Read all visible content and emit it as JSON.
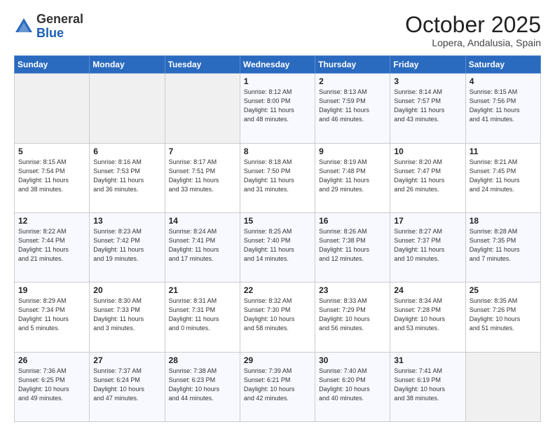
{
  "header": {
    "logo_general": "General",
    "logo_blue": "Blue",
    "month_title": "October 2025",
    "location": "Lopera, Andalusia, Spain"
  },
  "weekdays": [
    "Sunday",
    "Monday",
    "Tuesday",
    "Wednesday",
    "Thursday",
    "Friday",
    "Saturday"
  ],
  "weeks": [
    [
      {
        "day": "",
        "info": ""
      },
      {
        "day": "",
        "info": ""
      },
      {
        "day": "",
        "info": ""
      },
      {
        "day": "1",
        "info": "Sunrise: 8:12 AM\nSunset: 8:00 PM\nDaylight: 11 hours\nand 48 minutes."
      },
      {
        "day": "2",
        "info": "Sunrise: 8:13 AM\nSunset: 7:59 PM\nDaylight: 11 hours\nand 46 minutes."
      },
      {
        "day": "3",
        "info": "Sunrise: 8:14 AM\nSunset: 7:57 PM\nDaylight: 11 hours\nand 43 minutes."
      },
      {
        "day": "4",
        "info": "Sunrise: 8:15 AM\nSunset: 7:56 PM\nDaylight: 11 hours\nand 41 minutes."
      }
    ],
    [
      {
        "day": "5",
        "info": "Sunrise: 8:15 AM\nSunset: 7:54 PM\nDaylight: 11 hours\nand 38 minutes."
      },
      {
        "day": "6",
        "info": "Sunrise: 8:16 AM\nSunset: 7:53 PM\nDaylight: 11 hours\nand 36 minutes."
      },
      {
        "day": "7",
        "info": "Sunrise: 8:17 AM\nSunset: 7:51 PM\nDaylight: 11 hours\nand 33 minutes."
      },
      {
        "day": "8",
        "info": "Sunrise: 8:18 AM\nSunset: 7:50 PM\nDaylight: 11 hours\nand 31 minutes."
      },
      {
        "day": "9",
        "info": "Sunrise: 8:19 AM\nSunset: 7:48 PM\nDaylight: 11 hours\nand 29 minutes."
      },
      {
        "day": "10",
        "info": "Sunrise: 8:20 AM\nSunset: 7:47 PM\nDaylight: 11 hours\nand 26 minutes."
      },
      {
        "day": "11",
        "info": "Sunrise: 8:21 AM\nSunset: 7:45 PM\nDaylight: 11 hours\nand 24 minutes."
      }
    ],
    [
      {
        "day": "12",
        "info": "Sunrise: 8:22 AM\nSunset: 7:44 PM\nDaylight: 11 hours\nand 21 minutes."
      },
      {
        "day": "13",
        "info": "Sunrise: 8:23 AM\nSunset: 7:42 PM\nDaylight: 11 hours\nand 19 minutes."
      },
      {
        "day": "14",
        "info": "Sunrise: 8:24 AM\nSunset: 7:41 PM\nDaylight: 11 hours\nand 17 minutes."
      },
      {
        "day": "15",
        "info": "Sunrise: 8:25 AM\nSunset: 7:40 PM\nDaylight: 11 hours\nand 14 minutes."
      },
      {
        "day": "16",
        "info": "Sunrise: 8:26 AM\nSunset: 7:38 PM\nDaylight: 11 hours\nand 12 minutes."
      },
      {
        "day": "17",
        "info": "Sunrise: 8:27 AM\nSunset: 7:37 PM\nDaylight: 11 hours\nand 10 minutes."
      },
      {
        "day": "18",
        "info": "Sunrise: 8:28 AM\nSunset: 7:35 PM\nDaylight: 11 hours\nand 7 minutes."
      }
    ],
    [
      {
        "day": "19",
        "info": "Sunrise: 8:29 AM\nSunset: 7:34 PM\nDaylight: 11 hours\nand 5 minutes."
      },
      {
        "day": "20",
        "info": "Sunrise: 8:30 AM\nSunset: 7:33 PM\nDaylight: 11 hours\nand 3 minutes."
      },
      {
        "day": "21",
        "info": "Sunrise: 8:31 AM\nSunset: 7:31 PM\nDaylight: 11 hours\nand 0 minutes."
      },
      {
        "day": "22",
        "info": "Sunrise: 8:32 AM\nSunset: 7:30 PM\nDaylight: 10 hours\nand 58 minutes."
      },
      {
        "day": "23",
        "info": "Sunrise: 8:33 AM\nSunset: 7:29 PM\nDaylight: 10 hours\nand 56 minutes."
      },
      {
        "day": "24",
        "info": "Sunrise: 8:34 AM\nSunset: 7:28 PM\nDaylight: 10 hours\nand 53 minutes."
      },
      {
        "day": "25",
        "info": "Sunrise: 8:35 AM\nSunset: 7:26 PM\nDaylight: 10 hours\nand 51 minutes."
      }
    ],
    [
      {
        "day": "26",
        "info": "Sunrise: 7:36 AM\nSunset: 6:25 PM\nDaylight: 10 hours\nand 49 minutes."
      },
      {
        "day": "27",
        "info": "Sunrise: 7:37 AM\nSunset: 6:24 PM\nDaylight: 10 hours\nand 47 minutes."
      },
      {
        "day": "28",
        "info": "Sunrise: 7:38 AM\nSunset: 6:23 PM\nDaylight: 10 hours\nand 44 minutes."
      },
      {
        "day": "29",
        "info": "Sunrise: 7:39 AM\nSunset: 6:21 PM\nDaylight: 10 hours\nand 42 minutes."
      },
      {
        "day": "30",
        "info": "Sunrise: 7:40 AM\nSunset: 6:20 PM\nDaylight: 10 hours\nand 40 minutes."
      },
      {
        "day": "31",
        "info": "Sunrise: 7:41 AM\nSunset: 6:19 PM\nDaylight: 10 hours\nand 38 minutes."
      },
      {
        "day": "",
        "info": ""
      }
    ]
  ]
}
